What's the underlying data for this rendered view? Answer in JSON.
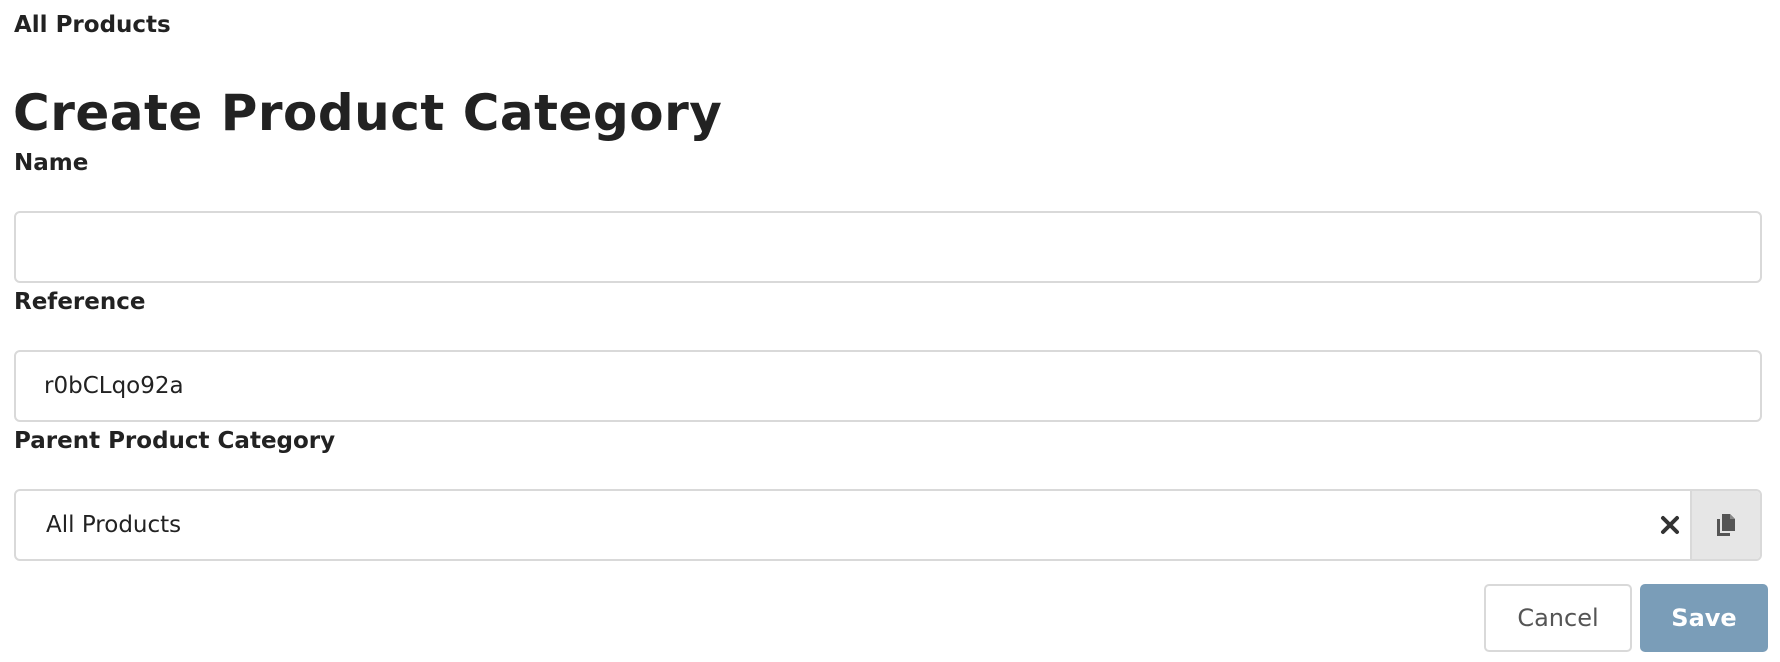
{
  "breadcrumb": {
    "label": "All Products"
  },
  "page": {
    "title": "Create Product Category"
  },
  "form": {
    "name": {
      "label": "Name",
      "value": "",
      "placeholder": ""
    },
    "reference": {
      "label": "Reference",
      "value": "r0bCLqo92a"
    },
    "parent_category": {
      "label": "Parent Product Category",
      "selected": "All Products",
      "clear_icon": "close-icon",
      "copy_icon": "copy-icon"
    }
  },
  "actions": {
    "cancel_label": "Cancel",
    "save_label": "Save"
  },
  "colors": {
    "text": "#222222",
    "border": "#d9d9d9",
    "save_button": "#7a9db8",
    "addon_background": "#e6e6e6"
  }
}
